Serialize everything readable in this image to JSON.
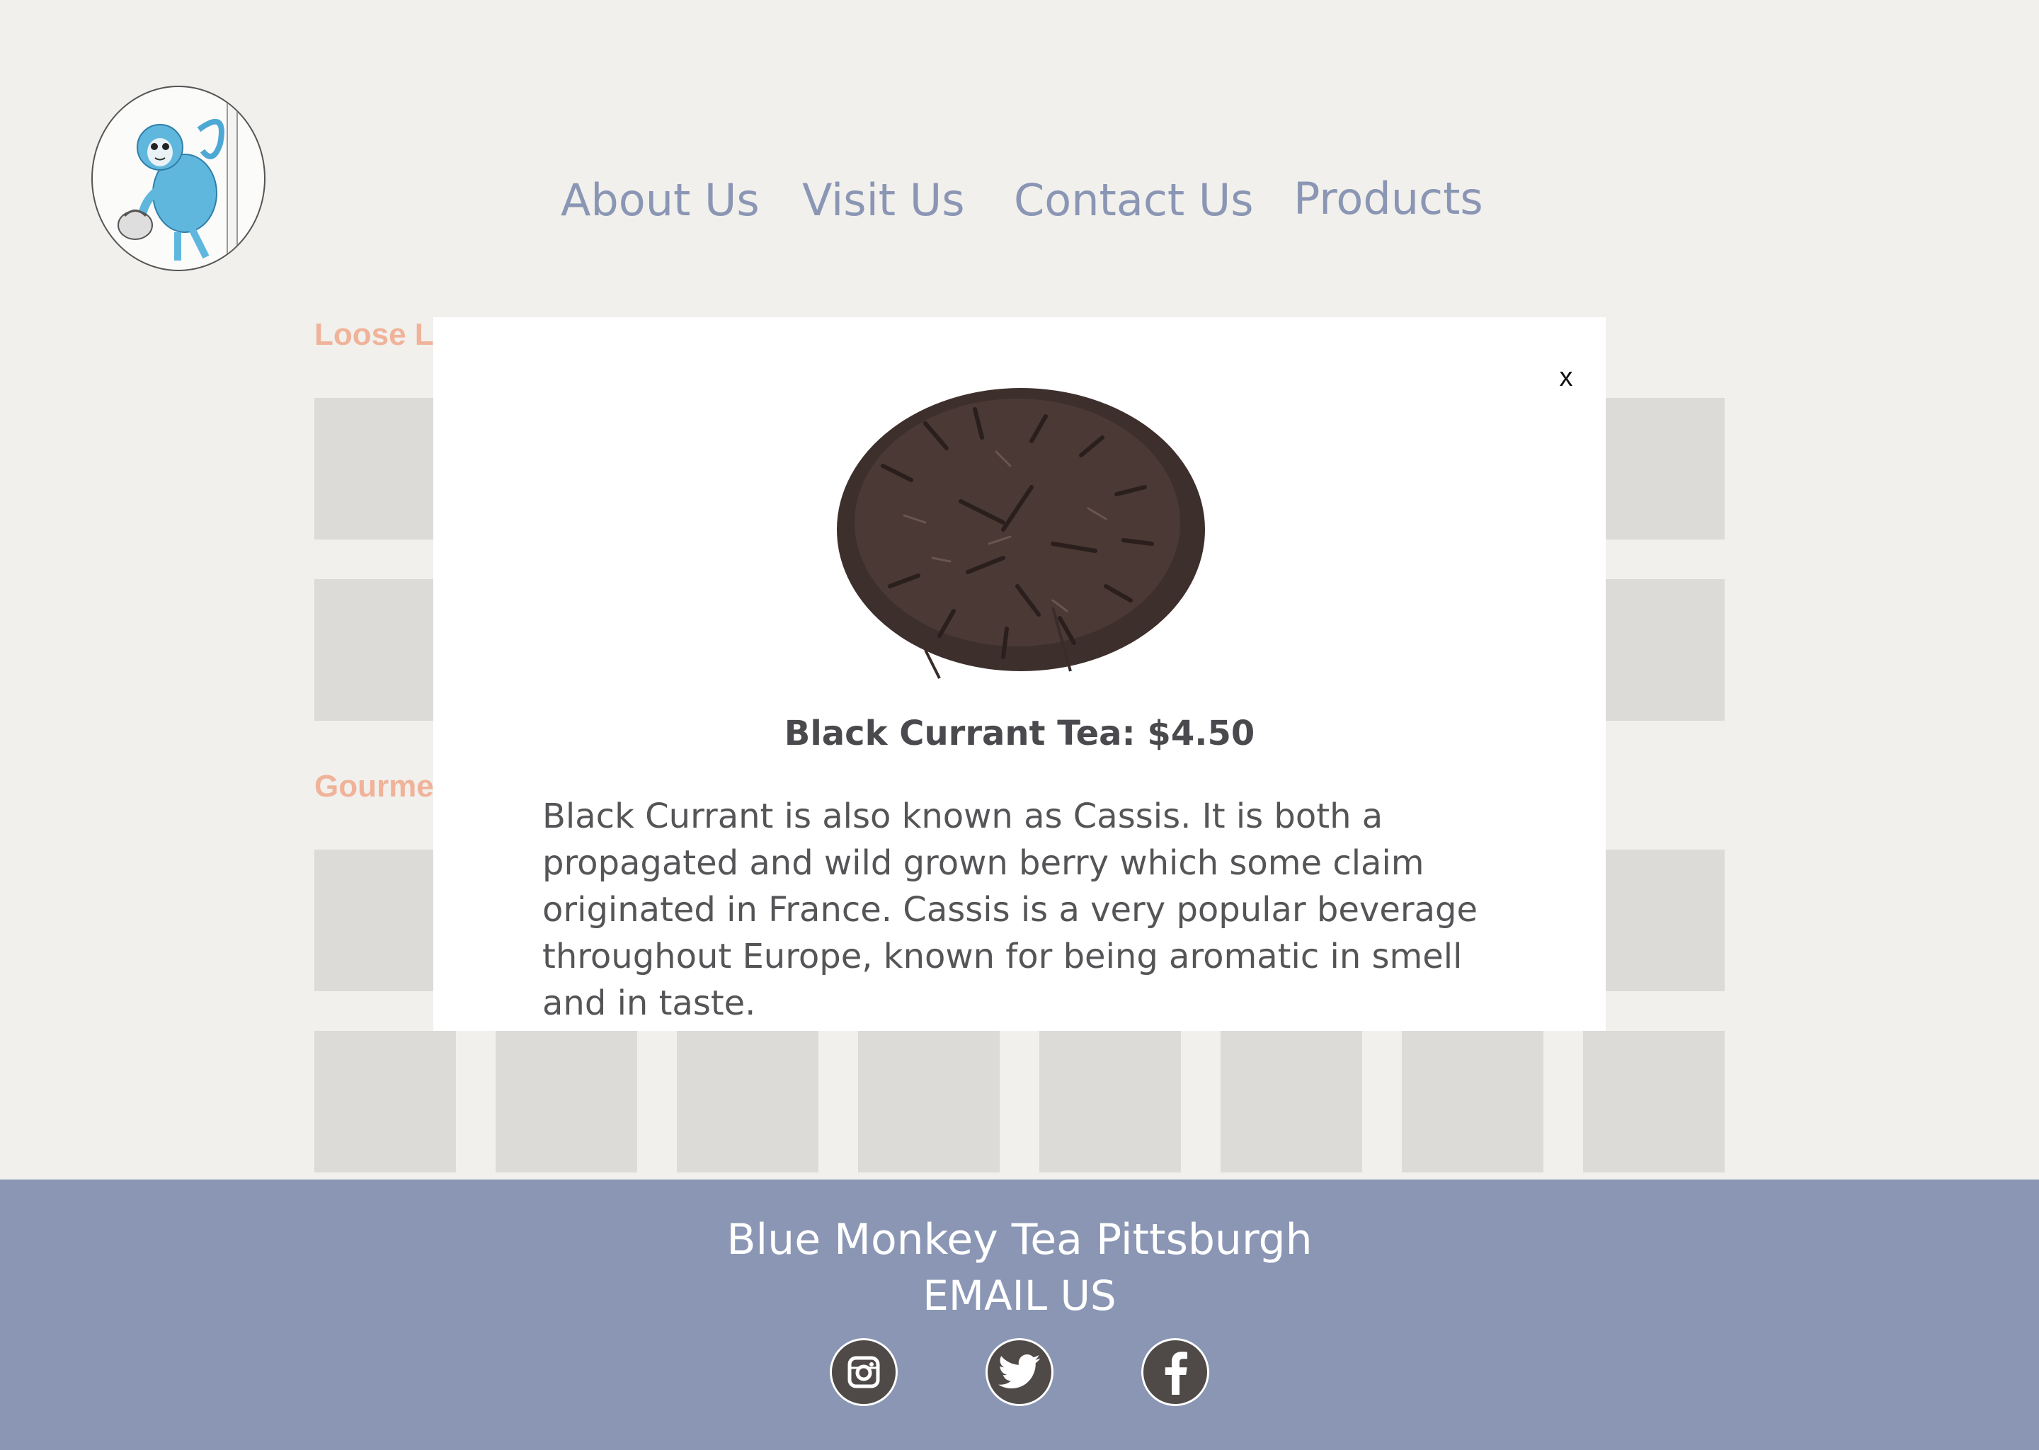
{
  "nav": {
    "items": [
      {
        "label": "About Us"
      },
      {
        "label": "Visit Us"
      },
      {
        "label": "Contact Us"
      },
      {
        "label": "Products"
      }
    ]
  },
  "sections": [
    {
      "title": "Loose L"
    },
    {
      "title": "Gourme"
    }
  ],
  "modal": {
    "close_label": "x",
    "product_title": "Black Currant Tea: $4.50",
    "description": "Black Currant is also known as Cassis. It is both a propagated and wild grown berry which some claim originated in France. Cassis is a very popular beverage throughout Europe, known for being aromatic in smell and in taste."
  },
  "footer": {
    "title": "Blue Monkey Tea Pittsburgh",
    "email_label": "EMAIL US",
    "social": [
      "instagram-icon",
      "twitter-icon",
      "facebook-icon"
    ]
  },
  "colors": {
    "background": "#f1f0ec",
    "nav_text": "#8a96b4",
    "section_title": "#f0b39a",
    "tile": "#dcdbd7",
    "footer_bg": "#8a96b4",
    "social_bg": "#4f4a47"
  }
}
